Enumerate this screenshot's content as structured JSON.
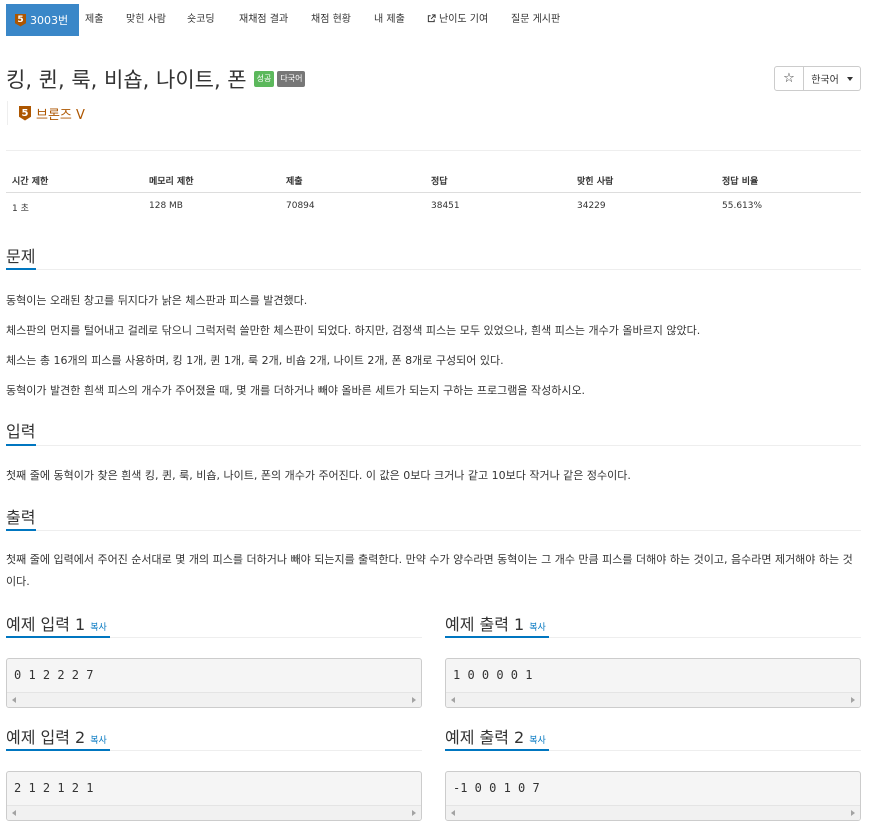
{
  "nav": {
    "active_badge": "5",
    "active_label": "3003번",
    "items": [
      "제출",
      "맞힌 사람",
      "숏코딩",
      "재채점 결과",
      "채점 현황",
      "내 제출",
      "난이도 기여",
      "질문 게시판"
    ]
  },
  "problem": {
    "title": "킹, 퀸, 룩, 비숍, 나이트, 폰",
    "labels": [
      "성공",
      "다국어"
    ],
    "star": "☆",
    "language": "한국어",
    "tier_badge": "5",
    "tier": "브론즈 V"
  },
  "info": {
    "headers": [
      "시간 제한",
      "메모리 제한",
      "제출",
      "정답",
      "맞힌 사람",
      "정답 비율"
    ],
    "values": [
      "1 초",
      "128 MB",
      "70894",
      "38451",
      "34229",
      "55.613%"
    ]
  },
  "description": {
    "heading": "문제",
    "paragraphs": [
      "동혁이는 오래된 창고를 뒤지다가 낡은 체스판과 피스를 발견했다.",
      "체스판의 먼지를 털어내고 걸레로 닦으니 그럭저럭 쓸만한 체스판이 되었다. 하지만, 검정색 피스는 모두 있었으나, 흰색 피스는 개수가 올바르지 않았다.",
      "체스는 총 16개의 피스를 사용하며, 킹 1개, 퀸 1개, 룩 2개, 비숍 2개, 나이트 2개, 폰 8개로 구성되어 있다.",
      "동혁이가 발견한 흰색 피스의 개수가 주어졌을 때, 몇 개를 더하거나 빼야 올바른 세트가 되는지 구하는 프로그램을 작성하시오."
    ]
  },
  "input": {
    "heading": "입력",
    "text": "첫째 줄에 동혁이가 찾은 흰색 킹, 퀸, 룩, 비숍, 나이트, 폰의 개수가 주어진다. 이 값은 0보다 크거나 같고 10보다 작거나 같은 정수이다."
  },
  "output": {
    "heading": "출력",
    "text": "첫째 줄에 입력에서 주어진 순서대로 몇 개의 피스를 더하거나 빼야 되는지를 출력한다. 만약 수가 양수라면 동혁이는 그 개수 만큼 피스를 더해야 하는 것이고, 음수라면 제거해야 하는 것이다."
  },
  "samples": [
    {
      "heading": "예제 입력 1",
      "copy": "복사",
      "content": "0 1 2 2 2 7"
    },
    {
      "heading": "예제 출력 1",
      "copy": "복사",
      "content": "1 0 0 0 0 1"
    },
    {
      "heading": "예제 입력 2",
      "copy": "복사",
      "content": "2 1 2 1 2 1"
    },
    {
      "heading": "예제 출력 2",
      "copy": "복사",
      "content": "-1 0 0 1 0 7"
    }
  ],
  "colors": {
    "nav_active": "#3a87c8",
    "bronze": "#ad5600",
    "success": "#5cb85c",
    "default_label": "#777777",
    "link": "#0076c0"
  }
}
